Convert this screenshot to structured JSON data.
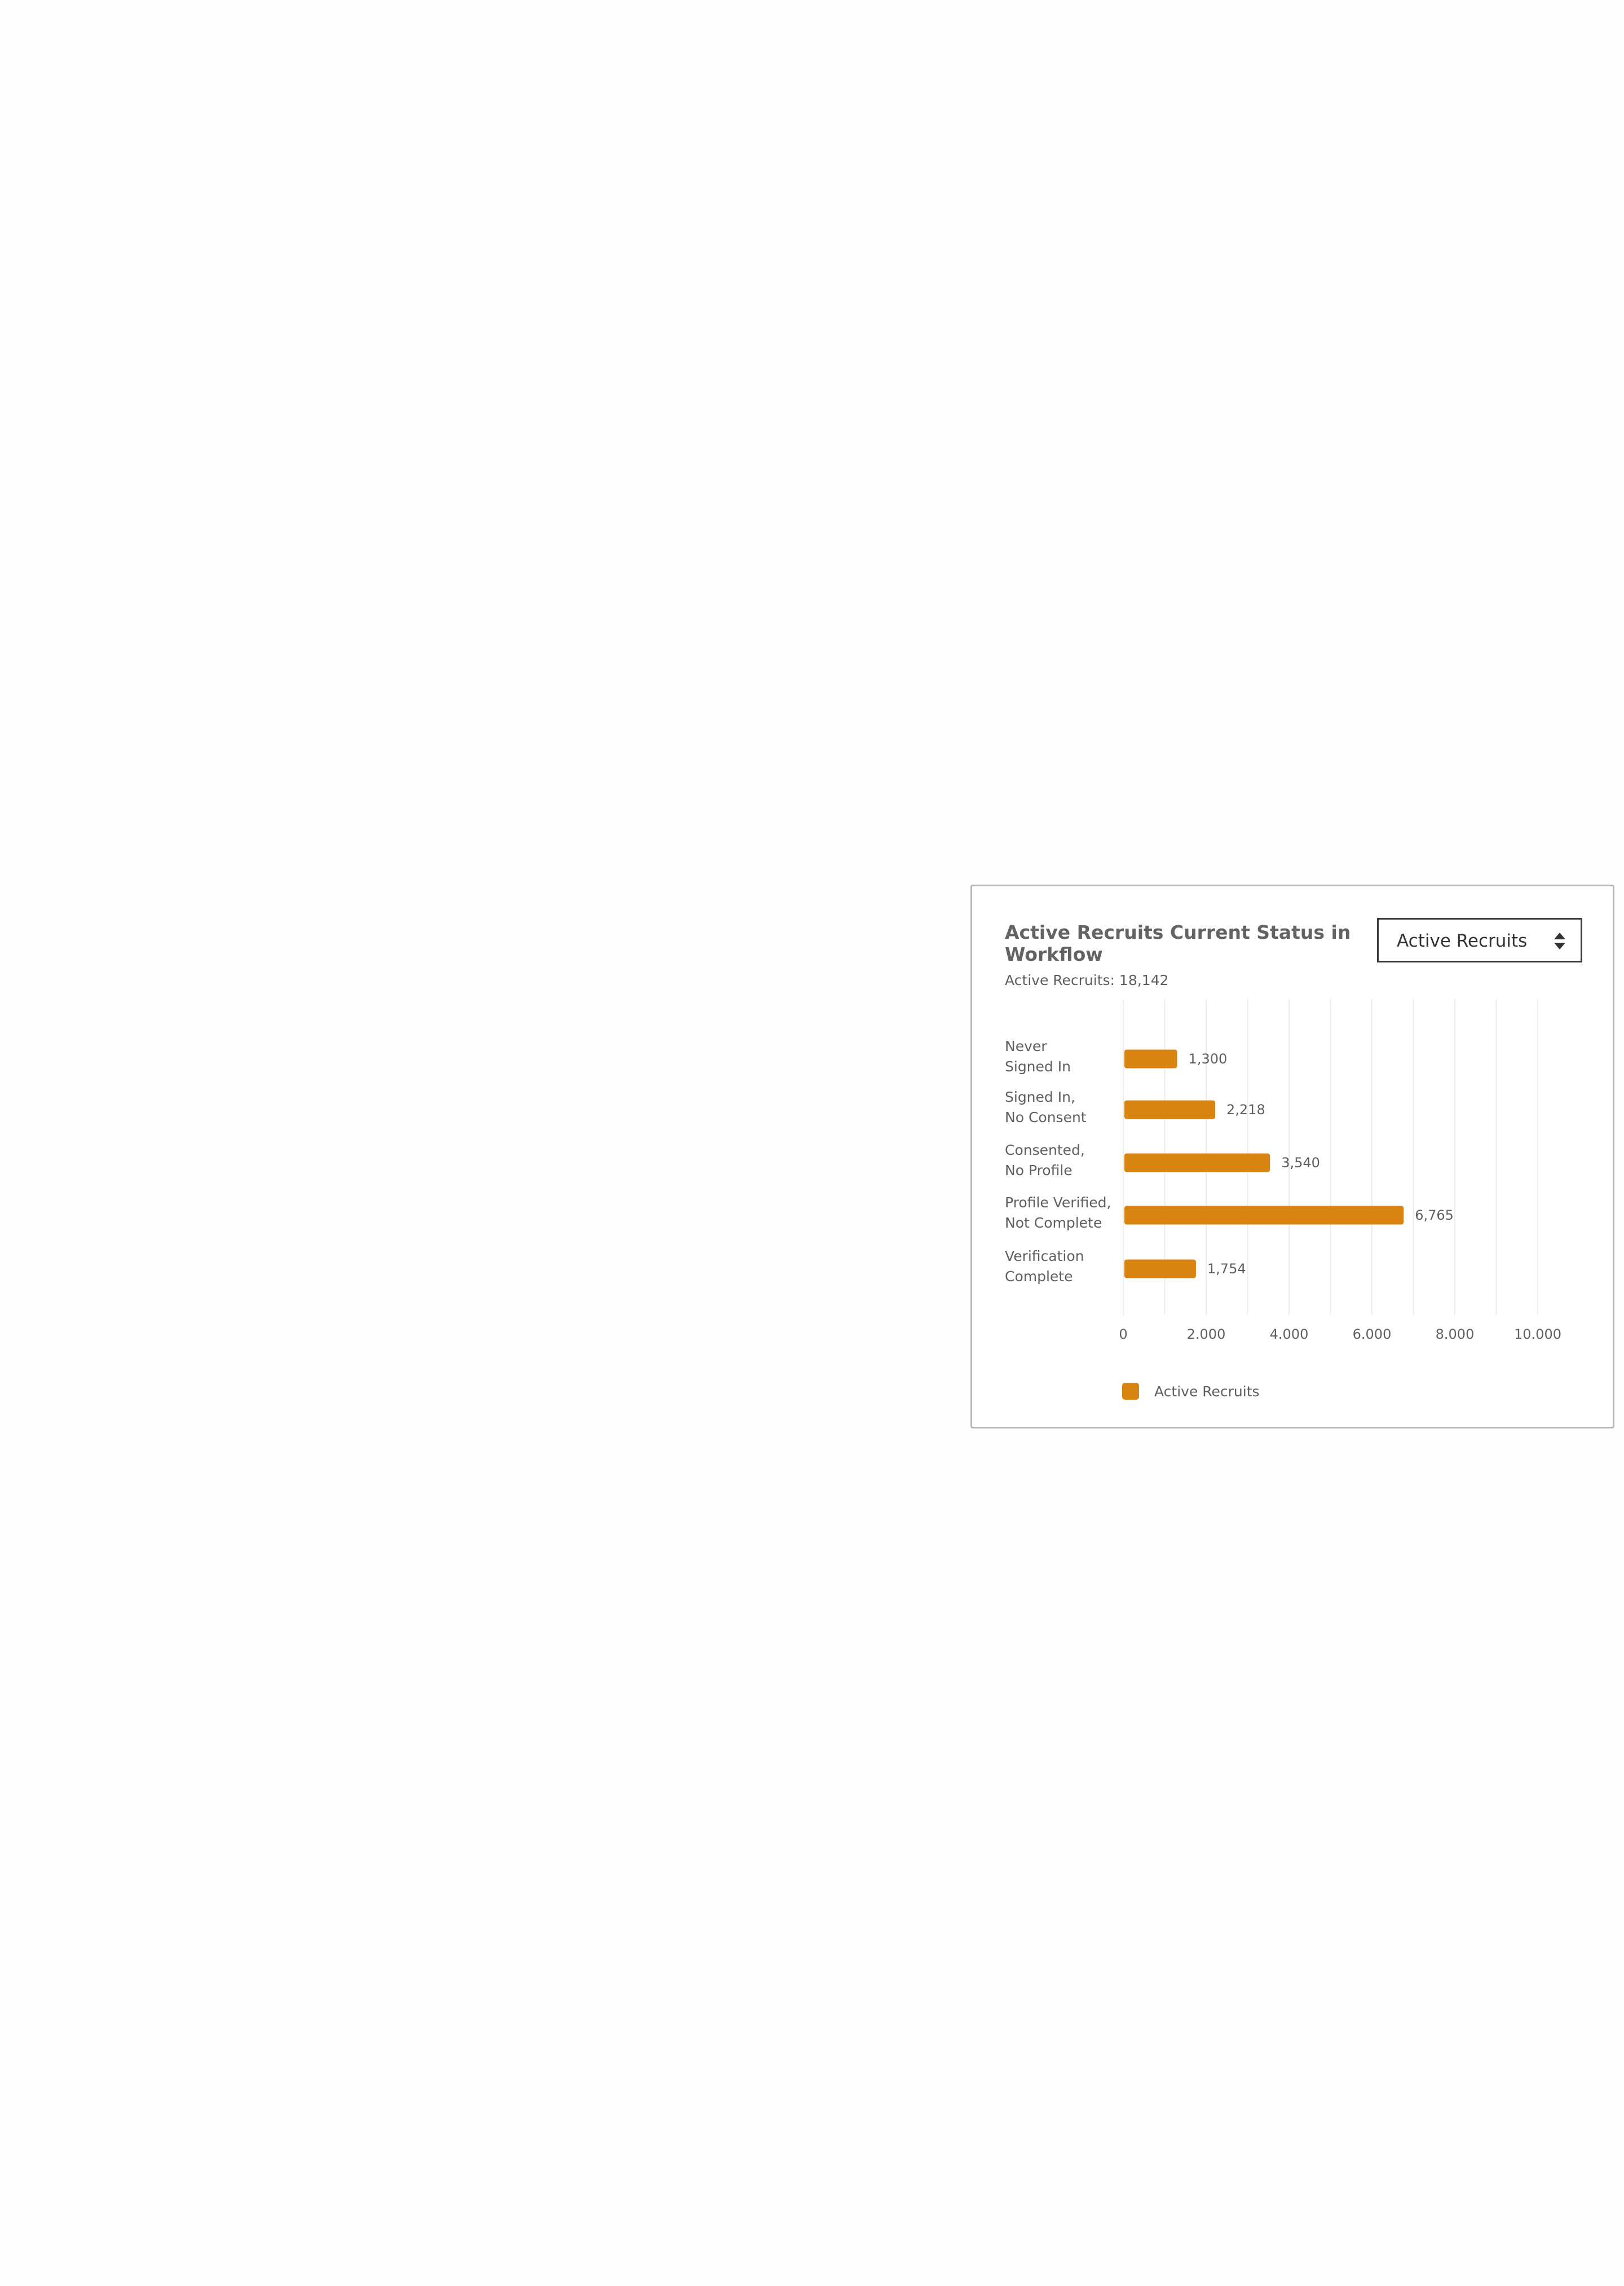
{
  "card": {
    "title": "Active Recruits Current Status in Workflow",
    "subtitle": "Active Recruits: 18,142"
  },
  "select": {
    "value": "Active Recruits",
    "icon": "sort-arrows-icon"
  },
  "colors": {
    "bar": "#d98310",
    "grid": "#ececec",
    "text": "#5f5f5f"
  },
  "chart_data": {
    "type": "bar",
    "orientation": "horizontal",
    "title": "Active Recruits Current Status in Workflow",
    "categories": [
      [
        "Never",
        "Signed In"
      ],
      [
        "Signed In,",
        "No Consent"
      ],
      [
        "Consented,",
        "No Profile"
      ],
      [
        "Profile Verified,",
        "Not Complete"
      ],
      [
        "Verification",
        "Complete"
      ]
    ],
    "series": [
      {
        "name": "Active Recruits",
        "values": [
          1300,
          2218,
          3540,
          6765,
          1754
        ],
        "labels": [
          "1,300",
          "2,218",
          "3,540",
          "6,765",
          "1,754"
        ]
      }
    ],
    "xlim": [
      0,
      10000
    ],
    "xticks": [
      0,
      2000,
      4000,
      6000,
      8000,
      10000
    ],
    "xtick_labels": [
      "0",
      "2.000",
      "4.000",
      "6.000",
      "8.000",
      "10.000"
    ],
    "grid_step": 1000,
    "grid": true,
    "legend": "bottom"
  }
}
